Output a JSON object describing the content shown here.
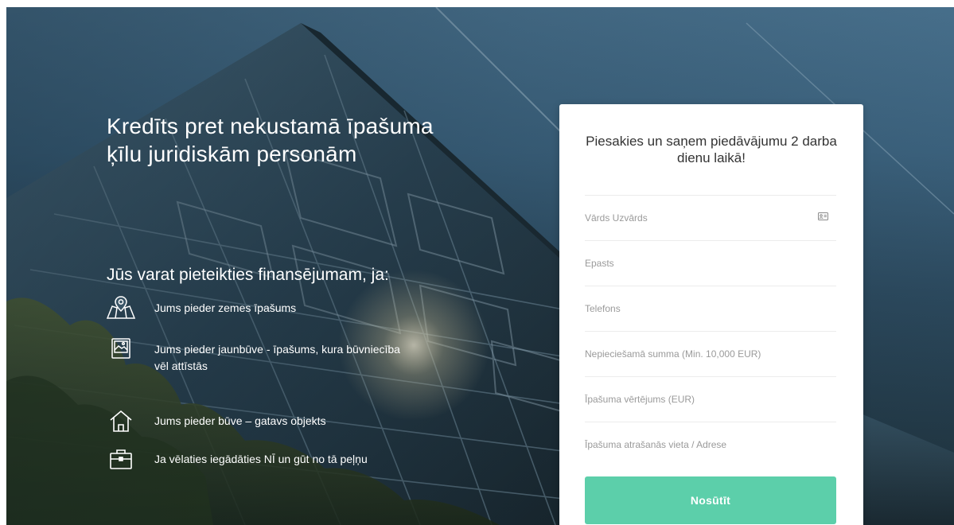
{
  "hero": {
    "title": "Kredīts pret nekustamā īpašuma ķīlu juridiskām personām",
    "subtitle": "Jūs varat pieteikties finansējumam, ja:",
    "features": [
      {
        "icon": "map-pin-icon",
        "text": "Jums pieder zemes īpašums"
      },
      {
        "icon": "image-icon",
        "text": "Jums pieder jaunbūve - īpašums, kura būvniecība vēl attīstās"
      },
      {
        "icon": "house-icon",
        "text": "Jums pieder būve – gatavs objekts"
      },
      {
        "icon": "briefcase-icon",
        "text": "Ja vēlaties iegādāties NĪ un gūt no tā peļņu"
      }
    ]
  },
  "form": {
    "title": "Piesakies un saņem piedāvājumu 2 darba dienu laikā!",
    "fields": [
      {
        "placeholder": "Vārds Uzvārds",
        "value": ""
      },
      {
        "placeholder": "Epasts",
        "value": ""
      },
      {
        "placeholder": "Telefons",
        "value": ""
      },
      {
        "placeholder": "Nepieciešamā summa (Min. 10,000 EUR)",
        "value": ""
      },
      {
        "placeholder": "Īpašuma vērtējums (EUR)",
        "value": ""
      },
      {
        "placeholder": "Īpašuma atrašanās vieta / Adrese",
        "value": ""
      }
    ],
    "contact_card_icon": "contact-card-icon",
    "submit_label": "Nosūtīt"
  },
  "colors": {
    "accent": "#5ccfaa",
    "hero_text": "#ffffff",
    "card_background": "#ffffff"
  }
}
